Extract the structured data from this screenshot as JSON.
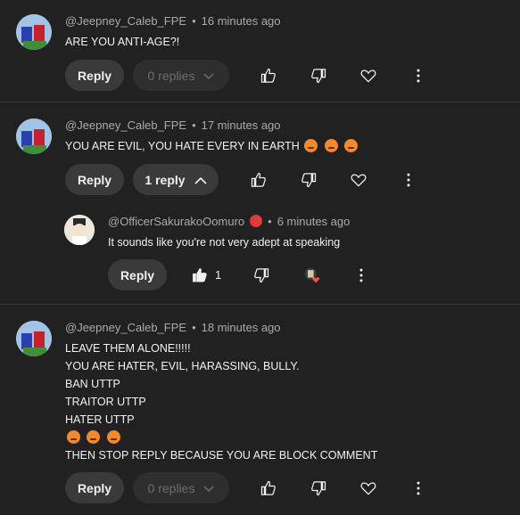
{
  "comments": [
    {
      "author": "@Jeepney_Caleb_FPE",
      "time": "16 minutes ago",
      "lines": [
        "ARE YOU ANTI-AGE?!"
      ],
      "reply_label": "Reply",
      "replies_label": "0 replies"
    },
    {
      "author": "@Jeepney_Caleb_FPE",
      "time": "17 minutes ago",
      "lines": [
        "YOU ARE EVIL, YOU HATE EVERY IN EARTH"
      ],
      "reply_label": "Reply",
      "replies_label": "1 reply"
    },
    {
      "author": "@Jeepney_Caleb_FPE",
      "time": "18 minutes ago",
      "lines": [
        "LEAVE THEM ALONE!!!!!",
        "YOU ARE HATER, EVIL, HARASSING, BULLY.",
        "BAN UTTP",
        "TRAITOR UTTP",
        "HATER UTTP",
        "",
        "THEN STOP REPLY BECAUSE YOU ARE BLOCK COMMENT"
      ],
      "reply_label": "Reply",
      "replies_label": "0 replies"
    }
  ],
  "reply": {
    "author": "@OfficerSakurakoOomuro",
    "time": "6 minutes ago",
    "text": "It sounds like you're not very adept at speaking",
    "reply_label": "Reply",
    "like_count": "1"
  },
  "separator": "•",
  "colors": {
    "background": "#212121",
    "button": "#3a3a3a",
    "muted": "#aaaaaa",
    "badge": "#e03a3a",
    "angry_emoji": "#f08a2a"
  }
}
